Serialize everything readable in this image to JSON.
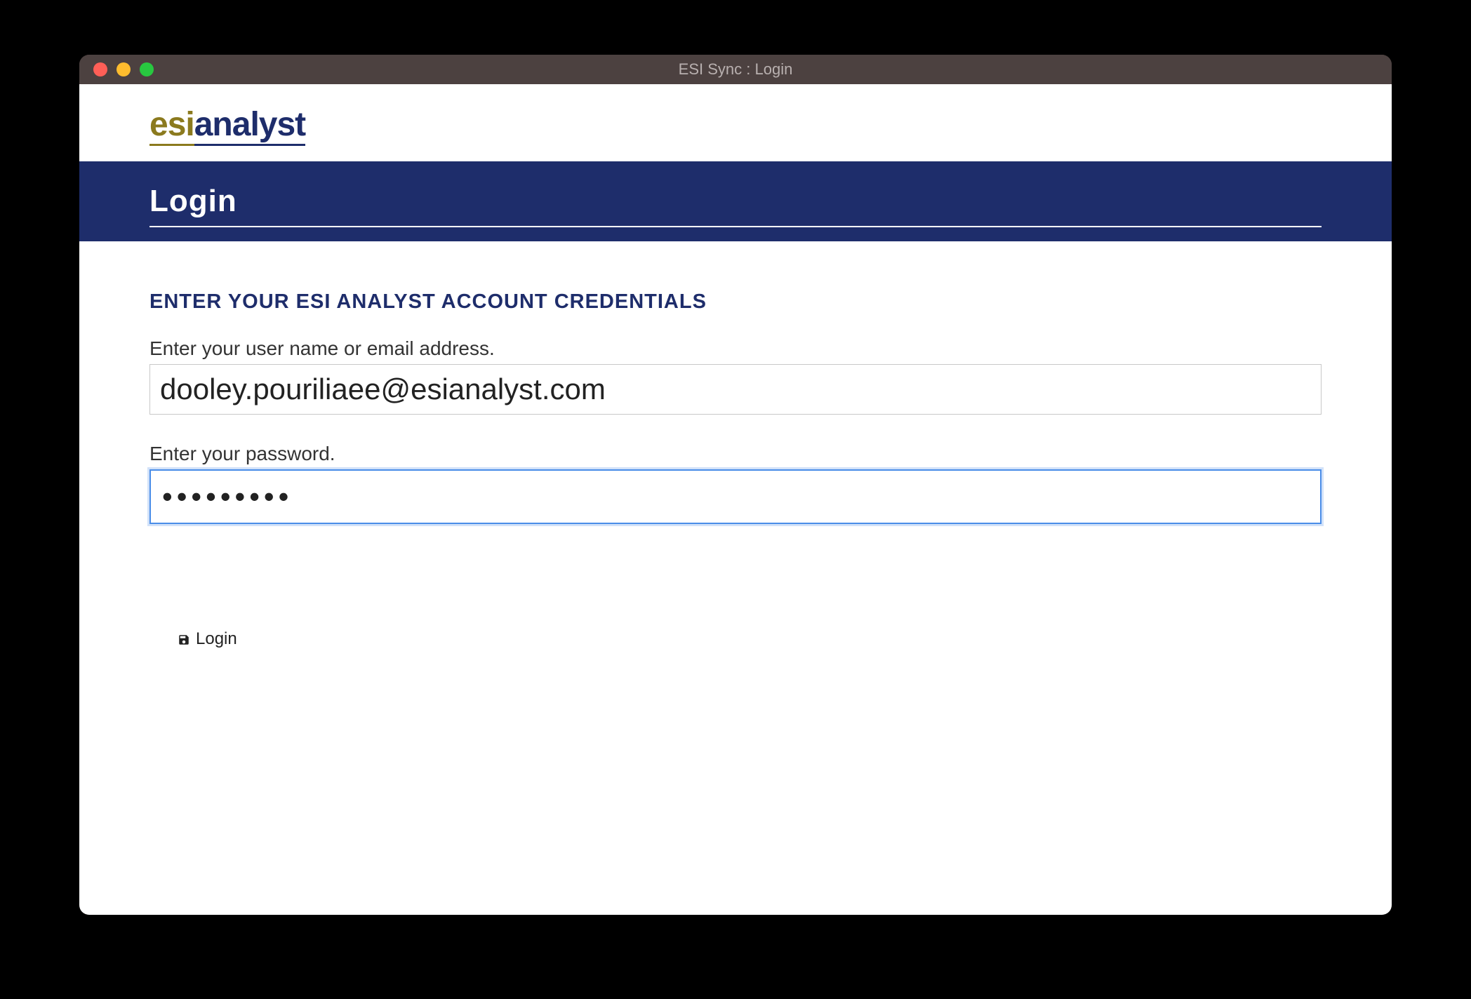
{
  "window": {
    "title": "ESI Sync : Login"
  },
  "logo": {
    "part1": "esi",
    "part2": "analyst"
  },
  "header": {
    "title": "Login"
  },
  "form": {
    "heading": "ENTER YOUR ESI ANALYST ACCOUNT CREDENTIALS",
    "username_label": "Enter your user name or email address.",
    "username_value": "dooley.pouriliaee@esianalyst.com",
    "password_label": "Enter your password.",
    "password_value": "•••••••••"
  },
  "actions": {
    "login_label": "Login"
  }
}
